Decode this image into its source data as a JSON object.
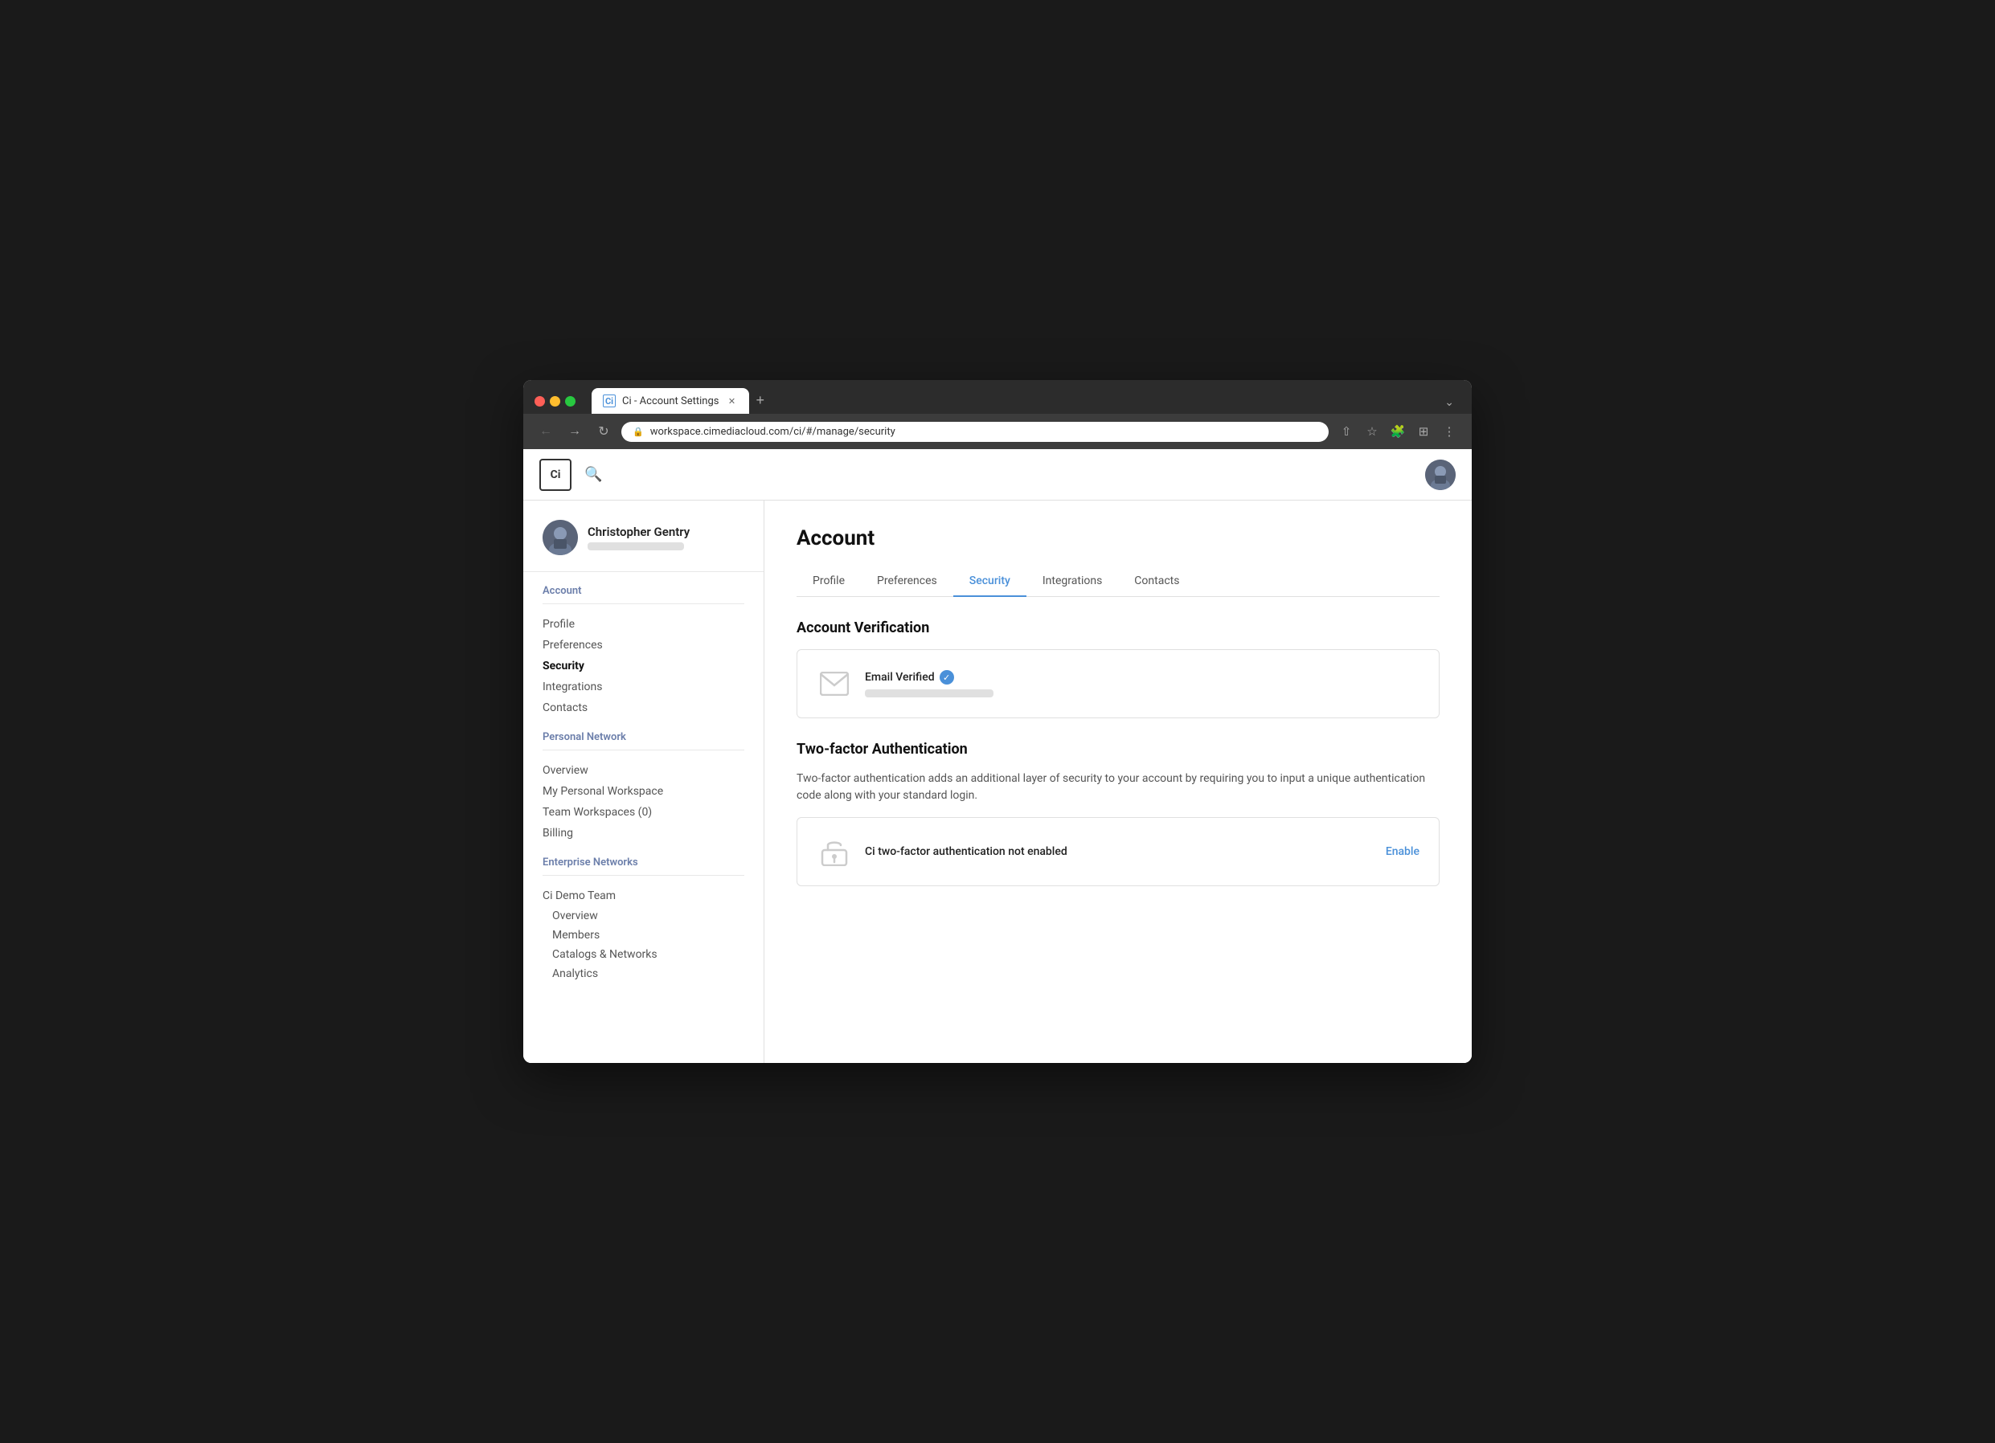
{
  "browser": {
    "tab_title": "Ci - Account Settings",
    "tab_favicon": "Ci",
    "url": "workspace.cimediacloud.com/ci/#/manage/security",
    "new_tab_icon": "+",
    "tab_menu_icon": "⌄"
  },
  "app": {
    "logo": "Ci",
    "page_title": "Account",
    "tabs": [
      {
        "label": "Profile",
        "active": false
      },
      {
        "label": "Preferences",
        "active": false
      },
      {
        "label": "Security",
        "active": true
      },
      {
        "label": "Integrations",
        "active": false
      },
      {
        "label": "Contacts",
        "active": false
      }
    ]
  },
  "sidebar": {
    "user": {
      "name": "Christopher Gentry"
    },
    "sections": [
      {
        "title": "Account",
        "links": [
          {
            "label": "Profile",
            "active": false
          },
          {
            "label": "Preferences",
            "active": false
          },
          {
            "label": "Security",
            "active": true
          },
          {
            "label": "Integrations",
            "active": false
          },
          {
            "label": "Contacts",
            "active": false
          }
        ]
      },
      {
        "title": "Personal Network",
        "links": [
          {
            "label": "Overview",
            "active": false
          },
          {
            "label": "My Personal Workspace",
            "active": false
          },
          {
            "label": "Team Workspaces (0)",
            "active": false
          },
          {
            "label": "Billing",
            "active": false
          }
        ]
      },
      {
        "title": "Enterprise Networks",
        "links": [
          {
            "label": "Ci Demo Team",
            "active": false,
            "type": "group"
          },
          {
            "label": "Overview",
            "active": false,
            "type": "sublink"
          },
          {
            "label": "Members",
            "active": false,
            "type": "sublink"
          },
          {
            "label": "Catalogs & Networks",
            "active": false,
            "type": "sublink"
          },
          {
            "label": "Analytics",
            "active": false,
            "type": "sublink"
          }
        ]
      }
    ]
  },
  "content": {
    "account_verification": {
      "section_title": "Account Verification",
      "email_verified_label": "Email Verified",
      "verified_check": "✓"
    },
    "two_factor": {
      "section_title": "Two-factor Authentication",
      "description": "Two-factor authentication adds an additional layer of security to your account by requiring you to input a unique authentication code along with your standard login.",
      "status_label": "Ci two-factor authentication not enabled",
      "enable_label": "Enable"
    }
  }
}
